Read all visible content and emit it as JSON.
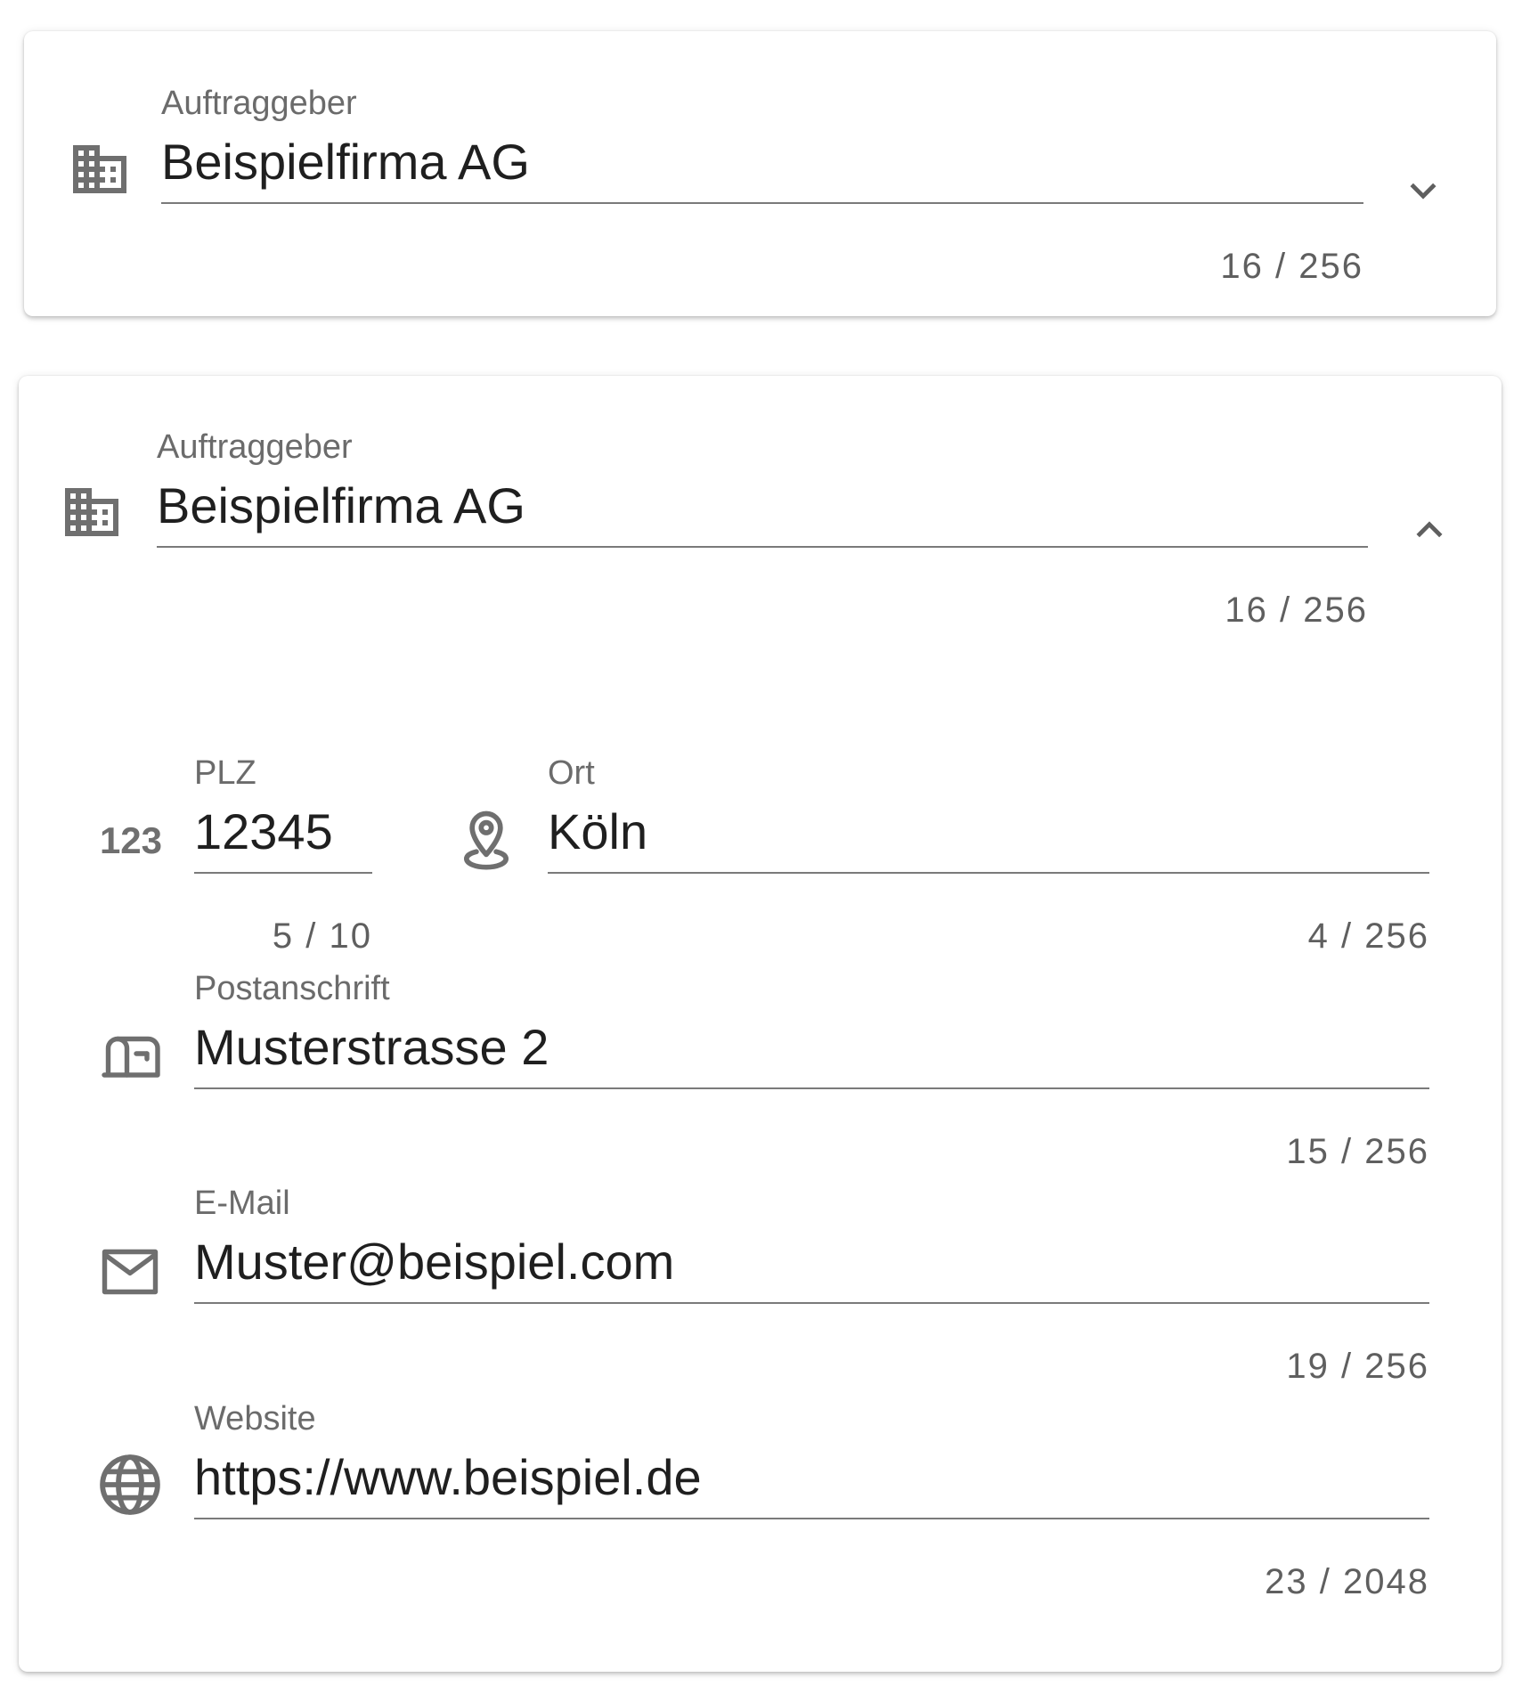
{
  "collapsed_card": {
    "client_label": "Auftraggeber",
    "client_value": "Beispielfirma AG",
    "client_counter": "16 / 256",
    "toggle_icon": "chevron-down-icon"
  },
  "expanded_card": {
    "client_label": "Auftraggeber",
    "client_value": "Beispielfirma AG",
    "client_counter": "16 / 256",
    "toggle_icon": "chevron-up-icon",
    "postal_code": {
      "label": "PLZ",
      "value": "12345",
      "counter": "5 / 10",
      "icon": "numeric-123-icon"
    },
    "city": {
      "label": "Ort",
      "value": "Köln",
      "counter": "4 / 256",
      "icon": "map-marker-icon"
    },
    "address": {
      "label": "Postanschrift",
      "value": "Musterstrasse 2",
      "counter": "15 / 256",
      "icon": "mailbox-icon"
    },
    "email": {
      "label": "E-Mail",
      "value": "Muster@beispiel.com",
      "counter": "19 / 256",
      "icon": "envelope-icon"
    },
    "website": {
      "label": "Website",
      "value": "https://www.beispiel.de",
      "counter": "23 / 2048",
      "icon": "globe-icon"
    }
  },
  "colors": {
    "icon": "#6f6f6f",
    "text": "#1f1f1f",
    "label": "#6b6b6b",
    "underline": "#7a7a7a"
  }
}
